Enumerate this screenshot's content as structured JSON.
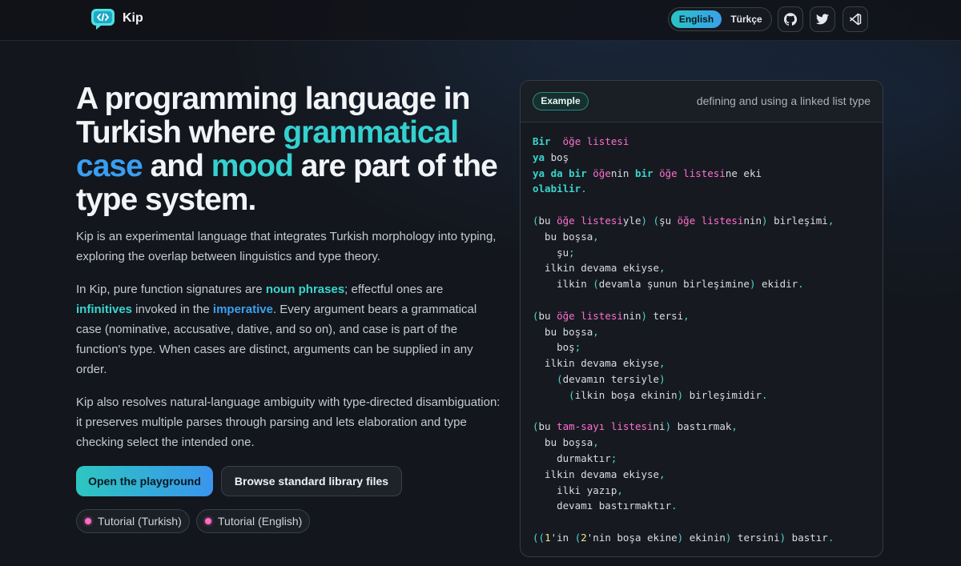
{
  "header": {
    "brand": "Kip",
    "lang_english": "English",
    "lang_turkish": "Türkçe",
    "icons": [
      "github-icon",
      "twitter-icon",
      "vscode-icon"
    ]
  },
  "hero": {
    "headline": {
      "part1": "A programming language in Turkish where ",
      "grammatical": "grammatical",
      "space": " ",
      "case": "case",
      "and": " and ",
      "mood": "mood",
      "part2": " are part of the type system."
    },
    "intro": "Kip is an experimental language that integrates Turkish morphology into typing, exploring the overlap between linguistics and type theory.",
    "p2": {
      "a": "In Kip, pure function signatures are ",
      "noun_phrases": "noun phrases",
      "b": "; effectful ones are ",
      "infinitives": "infinitives",
      "c": " invoked in the ",
      "imperative": "imperative",
      "d": ". Every argument bears a grammatical case (nominative, accusative, dative, and so on), and case is part of the function's type. When cases are distinct, arguments can be supplied in any order."
    },
    "p3": "Kip also resolves natural-language ambiguity with type-directed disambiguation: it preserves multiple parses through parsing and lets elaboration and type checking select the intended one.",
    "primary_button": "Open the playground",
    "secondary_button": "Browse standard library files",
    "chip_tr": "Tutorial (Turkish)",
    "chip_en": "Tutorial (English)"
  },
  "example": {
    "badge": "Example",
    "description": "defining and using a linked list type",
    "code_lines": [
      [
        [
          "kw",
          "Bir"
        ],
        [
          "",
          "  "
        ],
        [
          "ty",
          "öğe listesi"
        ]
      ],
      [
        [
          "kw",
          "ya"
        ],
        [
          "",
          " boş"
        ]
      ],
      [
        [
          "kw",
          "ya da bir"
        ],
        [
          "",
          " "
        ],
        [
          "ty",
          "öğe"
        ],
        [
          "",
          "nin "
        ],
        [
          "kw",
          "bir"
        ],
        [
          "",
          " "
        ],
        [
          "ty",
          "öğe listesi"
        ],
        [
          "",
          "ne eki"
        ]
      ],
      [
        [
          "kw",
          "olabilir"
        ],
        [
          "pn",
          "."
        ]
      ],
      [],
      [
        [
          "pn",
          "("
        ],
        [
          "",
          "bu "
        ],
        [
          "ty",
          "öğe listesi"
        ],
        [
          "",
          "yle"
        ],
        [
          "pn",
          ")"
        ],
        [
          "",
          " "
        ],
        [
          "pn",
          "("
        ],
        [
          "",
          "şu "
        ],
        [
          "ty",
          "öğe listesi"
        ],
        [
          "",
          "nin"
        ],
        [
          "pn",
          ")"
        ],
        [
          "",
          " birleşimi"
        ],
        [
          "pn",
          ","
        ]
      ],
      [
        [
          "",
          "  bu boşsa"
        ],
        [
          "pn",
          ","
        ]
      ],
      [
        [
          "",
          "    şu"
        ],
        [
          "pn",
          ";"
        ]
      ],
      [
        [
          "",
          "  ilkin devama ekiyse"
        ],
        [
          "pn",
          ","
        ]
      ],
      [
        [
          "",
          "    ilkin "
        ],
        [
          "pn",
          "("
        ],
        [
          "",
          "devamla şunun birleşimine"
        ],
        [
          "pn",
          ")"
        ],
        [
          "",
          " ekidir"
        ],
        [
          "pn",
          "."
        ]
      ],
      [],
      [
        [
          "pn",
          "("
        ],
        [
          "",
          "bu "
        ],
        [
          "ty",
          "öğe listesi"
        ],
        [
          "",
          "nin"
        ],
        [
          "pn",
          ")"
        ],
        [
          "",
          " tersi"
        ],
        [
          "pn",
          ","
        ]
      ],
      [
        [
          "",
          "  bu boşsa"
        ],
        [
          "pn",
          ","
        ]
      ],
      [
        [
          "",
          "    boş"
        ],
        [
          "pn",
          ";"
        ]
      ],
      [
        [
          "",
          "  ilkin devama ekiyse"
        ],
        [
          "pn",
          ","
        ]
      ],
      [
        [
          "",
          "    "
        ],
        [
          "pn",
          "("
        ],
        [
          "",
          "devamın tersiyle"
        ],
        [
          "pn",
          ")"
        ]
      ],
      [
        [
          "",
          "      "
        ],
        [
          "pn",
          "("
        ],
        [
          "",
          "ilkin boşa ekinin"
        ],
        [
          "pn",
          ")"
        ],
        [
          "",
          " birleşimidir"
        ],
        [
          "pn",
          "."
        ]
      ],
      [],
      [
        [
          "pn",
          "("
        ],
        [
          "",
          "bu "
        ],
        [
          "ty",
          "tam-sayı listesi"
        ],
        [
          "",
          "ni"
        ],
        [
          "pn",
          ")"
        ],
        [
          "",
          " bastırmak"
        ],
        [
          "pn",
          ","
        ]
      ],
      [
        [
          "",
          "  bu boşsa"
        ],
        [
          "pn",
          ","
        ]
      ],
      [
        [
          "",
          "    durmaktır"
        ],
        [
          "pn",
          ";"
        ]
      ],
      [
        [
          "",
          "  ilkin devama ekiyse"
        ],
        [
          "pn",
          ","
        ]
      ],
      [
        [
          "",
          "    ilki yazıp"
        ],
        [
          "pn",
          ","
        ]
      ],
      [
        [
          "",
          "    devamı bastırmaktır"
        ],
        [
          "pn",
          "."
        ]
      ],
      [],
      [
        [
          "pn",
          "(("
        ],
        [
          "nm",
          "1"
        ],
        [
          "",
          "'in "
        ],
        [
          "pn",
          "("
        ],
        [
          "nm",
          "2"
        ],
        [
          "",
          "'nin boşa ekine"
        ],
        [
          "pn",
          ")"
        ],
        [
          "",
          " ekinin"
        ],
        [
          "pn",
          ")"
        ],
        [
          "",
          " tersini"
        ],
        [
          "pn",
          ")"
        ],
        [
          "",
          " bastır"
        ],
        [
          "pn",
          "."
        ]
      ]
    ]
  },
  "colors": {
    "accent_teal": "#35d0d0",
    "accent_blue": "#3a9ef0",
    "code_keyword": "#38d4cc",
    "code_type": "#ff6ecf",
    "code_number": "#f3e58a"
  }
}
